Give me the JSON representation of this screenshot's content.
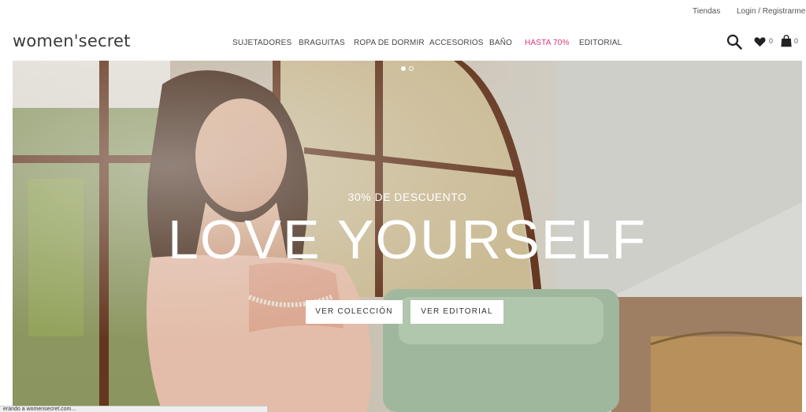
{
  "topbar": {
    "stores": "Tiendas",
    "login": "Login / Registrarme"
  },
  "header": {
    "logo": "women'secret",
    "nav": [
      {
        "label": "SUJETADORES"
      },
      {
        "label": "BRAGUITAS"
      },
      {
        "label": "ROPA DE DORMIR"
      },
      {
        "label": "ACCESORIOS"
      },
      {
        "label": "BAÑO"
      },
      {
        "label": "HASTA 70%"
      },
      {
        "label": "EDITORIAL"
      }
    ],
    "wishlist_count": "0",
    "cart_count": "0",
    "sale_color": "#e0327a"
  },
  "hero": {
    "subtitle": "30% DE DESCUENTO",
    "headline": "LOVE YOURSELF",
    "cta_primary": "VER COLECCIÓN",
    "cta_secondary": "VER EDITORIAL",
    "slides": 2,
    "active_slide": 1
  },
  "statusbar": {
    "text": "erando a womensecret.com..."
  }
}
